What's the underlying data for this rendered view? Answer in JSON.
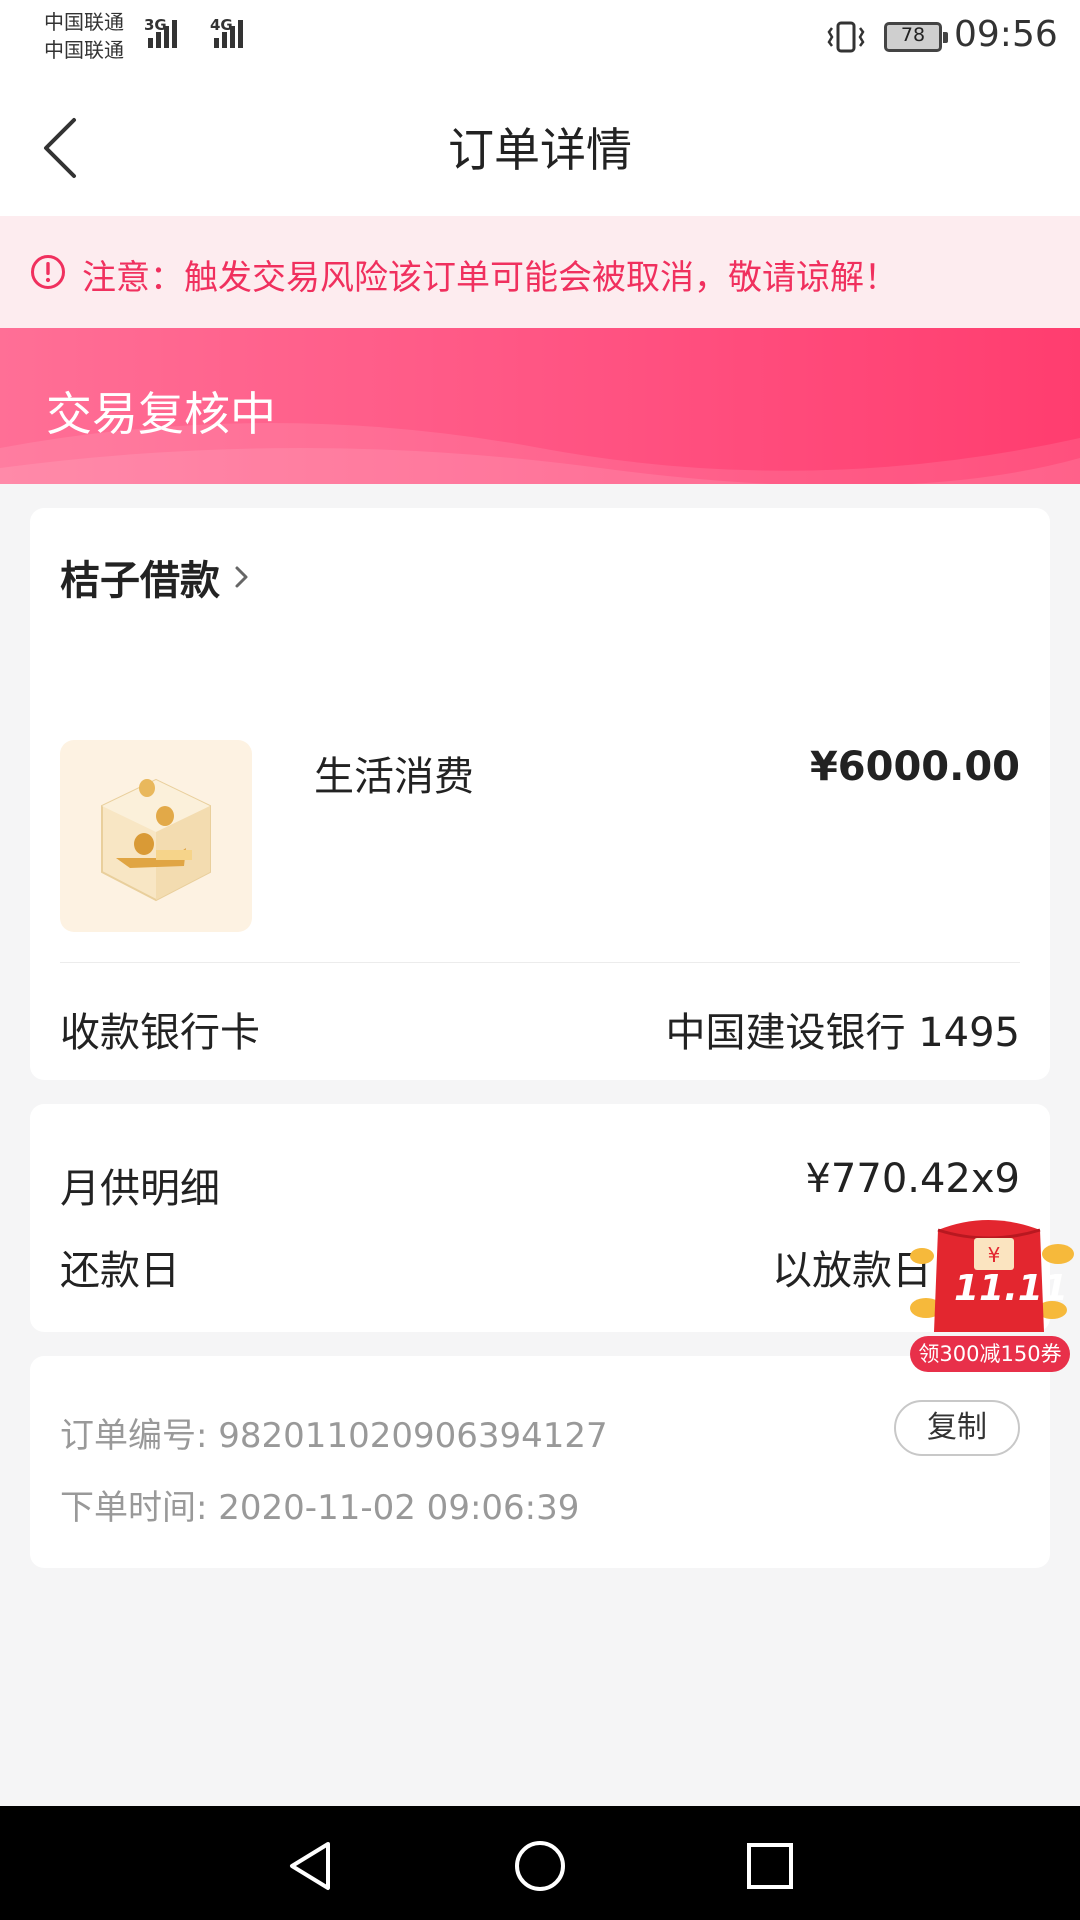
{
  "status_bar": {
    "carrier_1": "中国联通",
    "carrier_2": "中国联通",
    "network_1": "3G",
    "network_2": "4G",
    "battery": "78",
    "time": "09:56"
  },
  "header": {
    "title": "订单详情",
    "back_icon": "chevron-left-icon"
  },
  "notice": {
    "icon": "alert-circle-icon",
    "text": "注意：触发交易风险该订单可能会被取消，敬请谅解！",
    "color": "#f0305e"
  },
  "banner": {
    "status": "交易复核中",
    "color": "#ff5382"
  },
  "loan": {
    "lender": "桔子借款",
    "product_name": "生活消费",
    "amount": "¥6000.00",
    "bank_label": "收款银行卡",
    "bank_value": "中国建设银行 1495"
  },
  "repayment": {
    "monthly_label": "月供明细",
    "monthly_value": "¥770.42x9",
    "date_label": "还款日",
    "date_value": "以放款日"
  },
  "order": {
    "number_label": "订单编号:",
    "number_value": "982011020906394127",
    "time_label": "下单时间:",
    "time_value": "2020-11-02 09:06:39",
    "copy_label": "复制"
  },
  "promo": {
    "badge": "11.11",
    "label": "领300减150券"
  },
  "nav": {
    "back": "back-triangle-icon",
    "home": "home-circle-icon",
    "recents": "recents-square-icon"
  }
}
